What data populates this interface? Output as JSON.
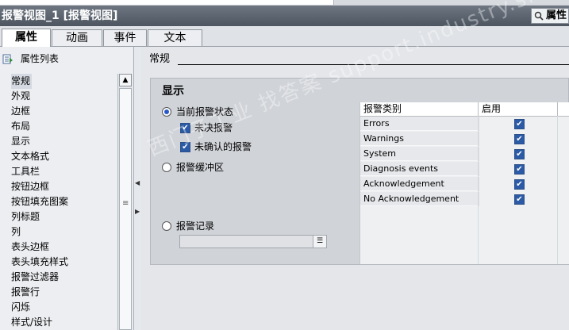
{
  "window": {
    "title": "报警视图_1 [报警视图]",
    "right_label": "属性"
  },
  "tabs": [
    {
      "label": "属性",
      "active": true
    },
    {
      "label": "动画",
      "active": false
    },
    {
      "label": "事件",
      "active": false
    },
    {
      "label": "文本",
      "active": false
    }
  ],
  "sidebar": {
    "header": "属性列表",
    "items": [
      "常规",
      "外观",
      "边框",
      "布局",
      "显示",
      "文本格式",
      "工具栏",
      "按钮边框",
      "按钮填充图案",
      "列标题",
      "列",
      "表头边框",
      "表头填充样式",
      "报警过滤器",
      "报警行",
      "闪烁",
      "样式/设计"
    ],
    "selected": "常规"
  },
  "section": {
    "title": "常规"
  },
  "display": {
    "group_title": "显示",
    "current_alarm_state": {
      "label": "当前报警状态",
      "selected": true
    },
    "unacked_pending": {
      "label": "未决报警",
      "checked": true
    },
    "unconfirmed": {
      "label": "未确认的报警",
      "checked": true
    },
    "alarm_buffer": {
      "label": "报警缓冲区",
      "selected": false
    },
    "alarm_log": {
      "label": "报警记录",
      "selected": false
    },
    "alarm_log_field": ""
  },
  "alarm_table": {
    "columns": [
      "报警类别",
      "启用"
    ],
    "rows": [
      {
        "name": "Errors",
        "enabled": true
      },
      {
        "name": "Warnings",
        "enabled": true
      },
      {
        "name": "System",
        "enabled": true
      },
      {
        "name": "Diagnosis events",
        "enabled": true
      },
      {
        "name": "Acknowledgement",
        "enabled": true
      },
      {
        "name": "No Acknowledgement",
        "enabled": true
      }
    ]
  },
  "watermark": "西门子工业 找答案 support.industry.siemens.com",
  "colors": {
    "titlebar": "#5a626d",
    "checkbox": "#2b5aa6",
    "radio_dot": "#2a58c9",
    "group_bg": "#d0d3d8"
  }
}
